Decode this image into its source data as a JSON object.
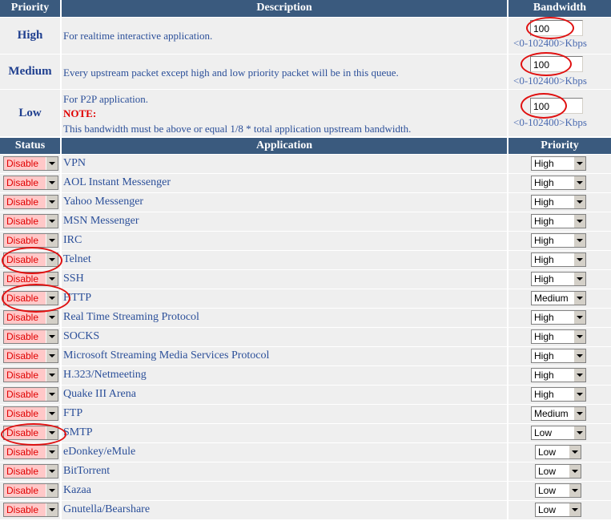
{
  "headers": {
    "priority": "Priority",
    "description": "Description",
    "bandwidth": "Bandwidth",
    "status": "Status",
    "application": "Application",
    "app_priority": "Priority"
  },
  "queues": [
    {
      "label": "High",
      "desc": "For realtime interactive application.",
      "value": "100",
      "range": "<0-102400>Kbps"
    },
    {
      "label": "Medium",
      "desc": "Every upstream packet except high and low priority packet will be in this queue.",
      "value": "100",
      "range": "<0-102400>Kbps"
    },
    {
      "label": "Low",
      "desc1": "For P2P application.",
      "note": "NOTE:",
      "desc2": "This bandwidth must be above or equal 1/8 * total application upstream bandwidth.",
      "value": "100",
      "range": "<0-102400>Kbps"
    }
  ],
  "apps": [
    {
      "status": "Disable",
      "name": "VPN",
      "priority": "High"
    },
    {
      "status": "Disable",
      "name": "AOL Instant Messenger",
      "priority": "High"
    },
    {
      "status": "Disable",
      "name": "Yahoo Messenger",
      "priority": "High"
    },
    {
      "status": "Disable",
      "name": "MSN Messenger",
      "priority": "High"
    },
    {
      "status": "Disable",
      "name": "IRC",
      "priority": "High"
    },
    {
      "status": "Disable",
      "name": "Telnet",
      "priority": "High"
    },
    {
      "status": "Disable",
      "name": "SSH",
      "priority": "High"
    },
    {
      "status": "Disable",
      "name": "HTTP",
      "priority": "Medium"
    },
    {
      "status": "Disable",
      "name": "Real Time Streaming Protocol",
      "priority": "High"
    },
    {
      "status": "Disable",
      "name": "SOCKS",
      "priority": "High"
    },
    {
      "status": "Disable",
      "name": "Microsoft Streaming Media Services Protocol",
      "priority": "High"
    },
    {
      "status": "Disable",
      "name": "H.323/Netmeeting",
      "priority": "High"
    },
    {
      "status": "Disable",
      "name": "Quake III Arena",
      "priority": "High"
    },
    {
      "status": "Disable",
      "name": "FTP",
      "priority": "Medium"
    },
    {
      "status": "Disable",
      "name": "SMTP",
      "priority": "Low"
    },
    {
      "status": "Disable",
      "name": "eDonkey/eMule",
      "priority": "Low"
    },
    {
      "status": "Disable",
      "name": "BitTorrent",
      "priority": "Low"
    },
    {
      "status": "Disable",
      "name": "Kazaa",
      "priority": "Low"
    },
    {
      "status": "Disable",
      "name": "Gnutella/Bearshare",
      "priority": "Low"
    }
  ],
  "colors": {
    "header_bg": "#3a5a7e",
    "row_bg": "#efefef",
    "link_text": "#2b4f99",
    "disable_bg": "#ffc8c8",
    "annotation": "#e01010"
  }
}
